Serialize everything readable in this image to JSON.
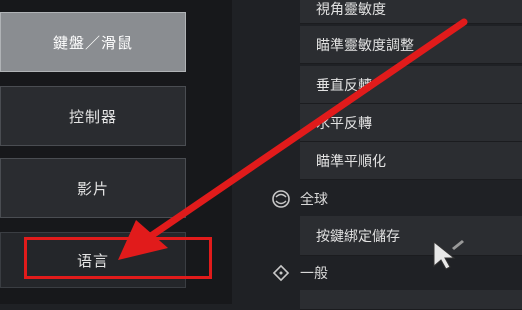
{
  "left_menu": {
    "items": [
      {
        "label": "鍵盤／滑鼠",
        "active": true
      },
      {
        "label": "控制器",
        "active": false
      },
      {
        "label": "影片",
        "active": false
      },
      {
        "label": "语言",
        "active": false
      }
    ]
  },
  "settings": {
    "items": [
      {
        "label": "視角靈敏度"
      },
      {
        "label": "瞄準靈敏度調整"
      },
      {
        "label": "垂直反轉"
      },
      {
        "label": "水平反轉"
      },
      {
        "label": "瞄準平順化"
      }
    ],
    "global_section": {
      "title": "全球",
      "items": [
        {
          "label": "按鍵綁定儲存"
        }
      ]
    },
    "general_section": {
      "title": "一般"
    }
  },
  "colors": {
    "annotation_red": "#e11b1b",
    "panel_bg": "#1f2125",
    "active_button_bg": "#8a8d91"
  }
}
